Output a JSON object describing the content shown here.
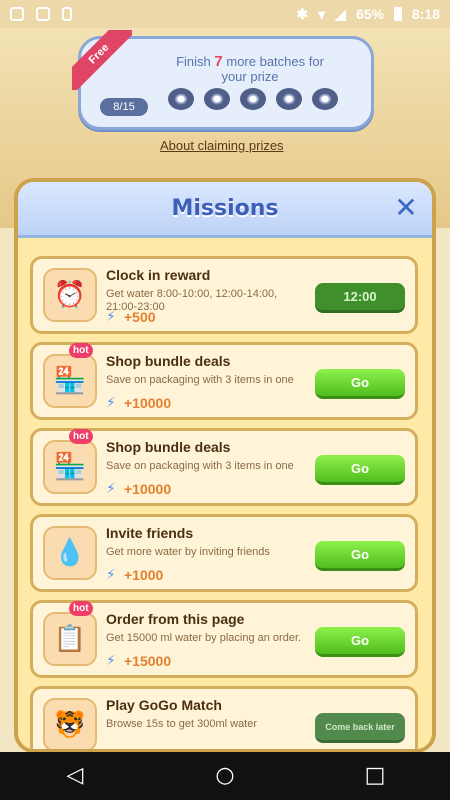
{
  "status_bar": {
    "battery": "65%",
    "time": "8:18"
  },
  "prize_bar": {
    "ribbon": "Free",
    "finish_prefix": "Finish",
    "finish_count": "7",
    "finish_suffix": "more batches for",
    "line2": "your prize",
    "progress": "8/15"
  },
  "claim_link": "About claiming prizes",
  "modal": {
    "title": "Missions",
    "close": "✕"
  },
  "missions": [
    {
      "title": "Clock in reward",
      "desc": "Get water 8:00-10:00, 12:00-14:00, 21:00-23:00",
      "reward": "+500",
      "button": "12:00",
      "hot": "",
      "icon": "⏰"
    },
    {
      "title": "Shop bundle deals",
      "desc": "Save on packaging with 3 items in one",
      "reward": "+10000",
      "button": "Go",
      "hot": "hot",
      "icon": "🏪"
    },
    {
      "title": "Shop bundle deals",
      "desc": "Save on packaging with 3 items in one",
      "reward": "+10000",
      "button": "Go",
      "hot": "hot",
      "icon": "🏪"
    },
    {
      "title": "Invite friends",
      "desc": "Get more water by inviting friends",
      "reward": "+1000",
      "button": "Go",
      "hot": "",
      "icon": "💧"
    },
    {
      "title": "Order from this page",
      "desc": "Get 15000 ml water by placing an order.",
      "reward": "+15000",
      "button": "Go",
      "hot": "hot",
      "icon": "📋"
    },
    {
      "title": "Play GoGo Match",
      "desc": "Browse 15s to get 300ml water",
      "reward": "",
      "button": "Come back later",
      "hot": "",
      "icon": "🐯"
    }
  ],
  "nav": {
    "back": "◁",
    "home": "○",
    "recent": "□"
  }
}
